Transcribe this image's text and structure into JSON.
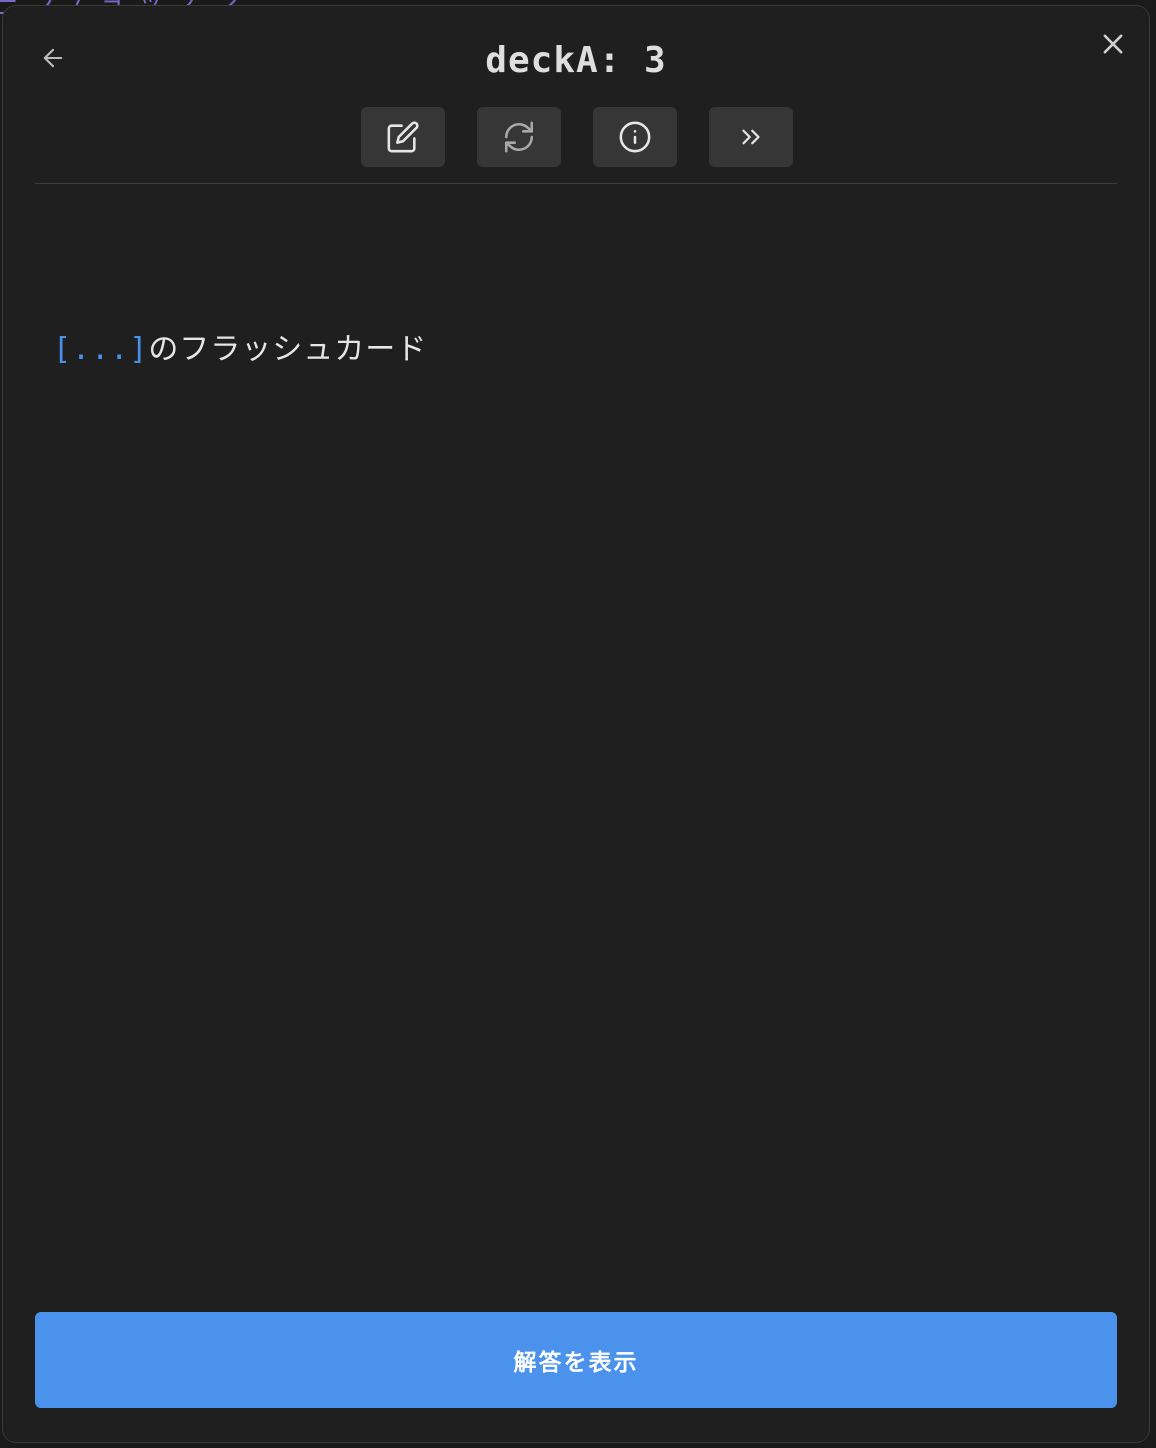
{
  "background": {
    "partial_link_text": "ー フ / ヨ ッ ノ ン"
  },
  "header": {
    "title": "deckA: 3",
    "back_icon": "arrow-left-icon",
    "close_icon": "close-icon"
  },
  "toolbar": {
    "buttons": [
      {
        "icon": "edit-icon"
      },
      {
        "icon": "refresh-icon"
      },
      {
        "icon": "info-icon"
      },
      {
        "icon": "skip-icon"
      }
    ]
  },
  "card": {
    "cloze": "[...]",
    "text": "のフラッシュカード"
  },
  "actions": {
    "show_answer_label": "解答を表示"
  },
  "colors": {
    "modal_bg": "#1f1f1f",
    "button_bg": "#363636",
    "accent": "#4a92ec",
    "cloze": "#4a8fe8"
  }
}
